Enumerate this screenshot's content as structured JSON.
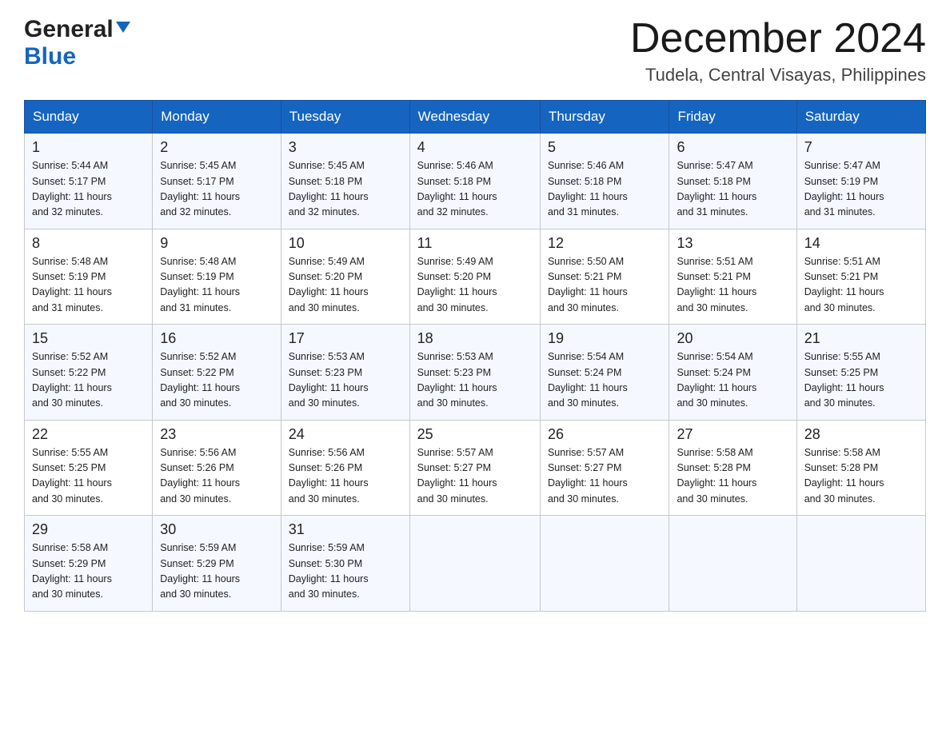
{
  "header": {
    "logo": {
      "general": "General",
      "blue": "Blue"
    },
    "title": "December 2024",
    "location": "Tudela, Central Visayas, Philippines"
  },
  "calendar": {
    "weekdays": [
      "Sunday",
      "Monday",
      "Tuesday",
      "Wednesday",
      "Thursday",
      "Friday",
      "Saturday"
    ],
    "weeks": [
      [
        {
          "day": "1",
          "info": "Sunrise: 5:44 AM\nSunset: 5:17 PM\nDaylight: 11 hours\nand 32 minutes."
        },
        {
          "day": "2",
          "info": "Sunrise: 5:45 AM\nSunset: 5:17 PM\nDaylight: 11 hours\nand 32 minutes."
        },
        {
          "day": "3",
          "info": "Sunrise: 5:45 AM\nSunset: 5:18 PM\nDaylight: 11 hours\nand 32 minutes."
        },
        {
          "day": "4",
          "info": "Sunrise: 5:46 AM\nSunset: 5:18 PM\nDaylight: 11 hours\nand 32 minutes."
        },
        {
          "day": "5",
          "info": "Sunrise: 5:46 AM\nSunset: 5:18 PM\nDaylight: 11 hours\nand 31 minutes."
        },
        {
          "day": "6",
          "info": "Sunrise: 5:47 AM\nSunset: 5:18 PM\nDaylight: 11 hours\nand 31 minutes."
        },
        {
          "day": "7",
          "info": "Sunrise: 5:47 AM\nSunset: 5:19 PM\nDaylight: 11 hours\nand 31 minutes."
        }
      ],
      [
        {
          "day": "8",
          "info": "Sunrise: 5:48 AM\nSunset: 5:19 PM\nDaylight: 11 hours\nand 31 minutes."
        },
        {
          "day": "9",
          "info": "Sunrise: 5:48 AM\nSunset: 5:19 PM\nDaylight: 11 hours\nand 31 minutes."
        },
        {
          "day": "10",
          "info": "Sunrise: 5:49 AM\nSunset: 5:20 PM\nDaylight: 11 hours\nand 30 minutes."
        },
        {
          "day": "11",
          "info": "Sunrise: 5:49 AM\nSunset: 5:20 PM\nDaylight: 11 hours\nand 30 minutes."
        },
        {
          "day": "12",
          "info": "Sunrise: 5:50 AM\nSunset: 5:21 PM\nDaylight: 11 hours\nand 30 minutes."
        },
        {
          "day": "13",
          "info": "Sunrise: 5:51 AM\nSunset: 5:21 PM\nDaylight: 11 hours\nand 30 minutes."
        },
        {
          "day": "14",
          "info": "Sunrise: 5:51 AM\nSunset: 5:21 PM\nDaylight: 11 hours\nand 30 minutes."
        }
      ],
      [
        {
          "day": "15",
          "info": "Sunrise: 5:52 AM\nSunset: 5:22 PM\nDaylight: 11 hours\nand 30 minutes."
        },
        {
          "day": "16",
          "info": "Sunrise: 5:52 AM\nSunset: 5:22 PM\nDaylight: 11 hours\nand 30 minutes."
        },
        {
          "day": "17",
          "info": "Sunrise: 5:53 AM\nSunset: 5:23 PM\nDaylight: 11 hours\nand 30 minutes."
        },
        {
          "day": "18",
          "info": "Sunrise: 5:53 AM\nSunset: 5:23 PM\nDaylight: 11 hours\nand 30 minutes."
        },
        {
          "day": "19",
          "info": "Sunrise: 5:54 AM\nSunset: 5:24 PM\nDaylight: 11 hours\nand 30 minutes."
        },
        {
          "day": "20",
          "info": "Sunrise: 5:54 AM\nSunset: 5:24 PM\nDaylight: 11 hours\nand 30 minutes."
        },
        {
          "day": "21",
          "info": "Sunrise: 5:55 AM\nSunset: 5:25 PM\nDaylight: 11 hours\nand 30 minutes."
        }
      ],
      [
        {
          "day": "22",
          "info": "Sunrise: 5:55 AM\nSunset: 5:25 PM\nDaylight: 11 hours\nand 30 minutes."
        },
        {
          "day": "23",
          "info": "Sunrise: 5:56 AM\nSunset: 5:26 PM\nDaylight: 11 hours\nand 30 minutes."
        },
        {
          "day": "24",
          "info": "Sunrise: 5:56 AM\nSunset: 5:26 PM\nDaylight: 11 hours\nand 30 minutes."
        },
        {
          "day": "25",
          "info": "Sunrise: 5:57 AM\nSunset: 5:27 PM\nDaylight: 11 hours\nand 30 minutes."
        },
        {
          "day": "26",
          "info": "Sunrise: 5:57 AM\nSunset: 5:27 PM\nDaylight: 11 hours\nand 30 minutes."
        },
        {
          "day": "27",
          "info": "Sunrise: 5:58 AM\nSunset: 5:28 PM\nDaylight: 11 hours\nand 30 minutes."
        },
        {
          "day": "28",
          "info": "Sunrise: 5:58 AM\nSunset: 5:28 PM\nDaylight: 11 hours\nand 30 minutes."
        }
      ],
      [
        {
          "day": "29",
          "info": "Sunrise: 5:58 AM\nSunset: 5:29 PM\nDaylight: 11 hours\nand 30 minutes."
        },
        {
          "day": "30",
          "info": "Sunrise: 5:59 AM\nSunset: 5:29 PM\nDaylight: 11 hours\nand 30 minutes."
        },
        {
          "day": "31",
          "info": "Sunrise: 5:59 AM\nSunset: 5:30 PM\nDaylight: 11 hours\nand 30 minutes."
        },
        {
          "day": "",
          "info": ""
        },
        {
          "day": "",
          "info": ""
        },
        {
          "day": "",
          "info": ""
        },
        {
          "day": "",
          "info": ""
        }
      ]
    ]
  }
}
